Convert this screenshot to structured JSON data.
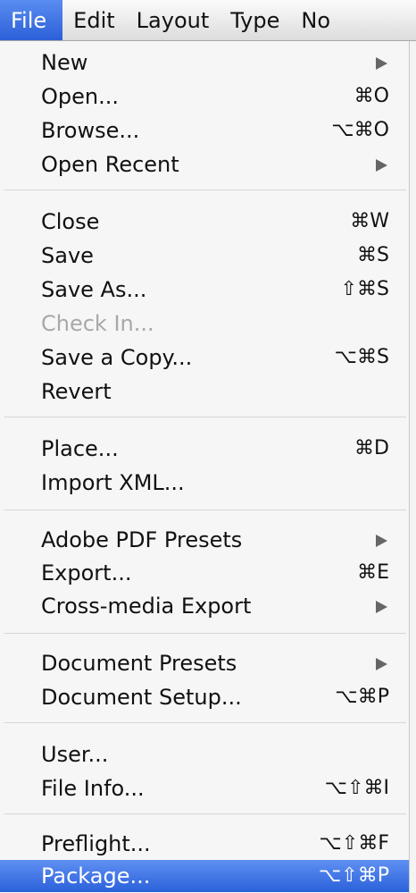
{
  "menubar": {
    "items": [
      "File",
      "Edit",
      "Layout",
      "Type",
      "No"
    ]
  },
  "menu": {
    "items": [
      {
        "label": "New",
        "shortcut": "",
        "submenu": true,
        "disabled": false
      },
      {
        "label": "Open...",
        "shortcut": "⌘O",
        "submenu": false,
        "disabled": false
      },
      {
        "label": "Browse...",
        "shortcut": "⌥⌘O",
        "submenu": false,
        "disabled": false
      },
      {
        "label": "Open Recent",
        "shortcut": "",
        "submenu": true,
        "disabled": false
      },
      {
        "label": "Close",
        "shortcut": "⌘W",
        "submenu": false,
        "disabled": false
      },
      {
        "label": "Save",
        "shortcut": "⌘S",
        "submenu": false,
        "disabled": false
      },
      {
        "label": "Save As...",
        "shortcut": "⇧⌘S",
        "submenu": false,
        "disabled": false
      },
      {
        "label": "Check In...",
        "shortcut": "",
        "submenu": false,
        "disabled": true
      },
      {
        "label": "Save a Copy...",
        "shortcut": "⌥⌘S",
        "submenu": false,
        "disabled": false
      },
      {
        "label": "Revert",
        "shortcut": "",
        "submenu": false,
        "disabled": false
      },
      {
        "label": "Place...",
        "shortcut": "⌘D",
        "submenu": false,
        "disabled": false
      },
      {
        "label": "Import XML...",
        "shortcut": "",
        "submenu": false,
        "disabled": false
      },
      {
        "label": "Adobe PDF Presets",
        "shortcut": "",
        "submenu": true,
        "disabled": false
      },
      {
        "label": "Export...",
        "shortcut": "⌘E",
        "submenu": false,
        "disabled": false
      },
      {
        "label": "Cross-media Export",
        "shortcut": "",
        "submenu": true,
        "disabled": false
      },
      {
        "label": "Document Presets",
        "shortcut": "",
        "submenu": true,
        "disabled": false
      },
      {
        "label": "Document Setup...",
        "shortcut": "⌥⌘P",
        "submenu": false,
        "disabled": false
      },
      {
        "label": "User...",
        "shortcut": "",
        "submenu": false,
        "disabled": false
      },
      {
        "label": "File Info...",
        "shortcut": "⌥⇧⌘I",
        "submenu": false,
        "disabled": false
      },
      {
        "label": "Preflight...",
        "shortcut": "⌥⇧⌘F",
        "submenu": false,
        "disabled": false
      },
      {
        "label": "Package...",
        "shortcut": "⌥⇧⌘P",
        "submenu": false,
        "disabled": false,
        "highlighted": true
      }
    ]
  },
  "colors": {
    "highlight": "#2b61da",
    "disabled_text": "#a8a8a8"
  }
}
